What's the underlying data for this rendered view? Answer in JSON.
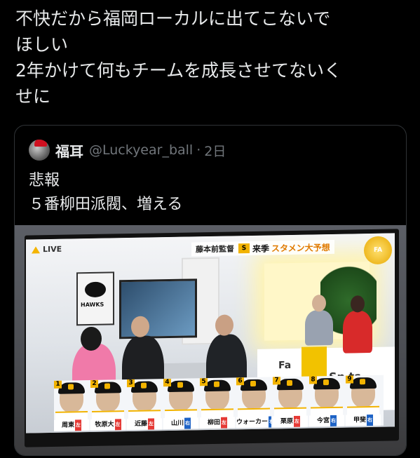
{
  "post": {
    "lines": [
      "不快だから福岡ローカルに出てこないで",
      "ほしい",
      "2年かけて何もチームを成長させてないく",
      "せに"
    ]
  },
  "quote": {
    "display_name": "福耳",
    "handle": "@Luckyear_ball",
    "separator": "·",
    "time": "2日",
    "text_lines": [
      "悲報",
      " ５番柳田派閥、増える"
    ],
    "avatar_icon": "santa-hat-avatar"
  },
  "tv": {
    "live_label": "LIVE",
    "banner_host": "藤本前監督",
    "banner_logo": "S",
    "banner_title_a": "来季",
    "banner_title_b": "スタメン大予想",
    "badge_text": "FA",
    "poster_text": "HAWKS",
    "desk_text_a": "Fa",
    "desk_text_b": "Sp   ts",
    "lineup": [
      {
        "num": "1",
        "name": "周東",
        "pos": "左",
        "pos_color": "#e53935"
      },
      {
        "num": "2",
        "name": "牧原大",
        "pos": "左",
        "pos_color": "#e53935"
      },
      {
        "num": "3",
        "name": "近藤",
        "pos": "左",
        "pos_color": "#e53935"
      },
      {
        "num": "4",
        "name": "山川",
        "pos": "右",
        "pos_color": "#1e63c6"
      },
      {
        "num": "5",
        "name": "柳田",
        "pos": "左",
        "pos_color": "#e53935"
      },
      {
        "num": "6",
        "name": "ウォーカー",
        "pos": "右",
        "pos_color": "#1e63c6"
      },
      {
        "num": "7",
        "name": "栗原",
        "pos": "左",
        "pos_color": "#e53935"
      },
      {
        "num": "8",
        "name": "今宮",
        "pos": "右",
        "pos_color": "#1e63c6"
      },
      {
        "num": "9",
        "name": "甲斐",
        "pos": "右",
        "pos_color": "#1e63c6"
      }
    ]
  }
}
